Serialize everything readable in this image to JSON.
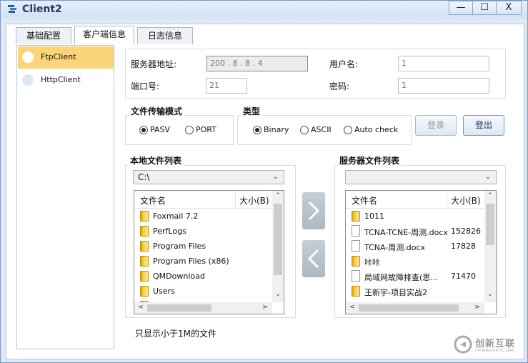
{
  "window": {
    "title": "Client2",
    "minimize": "—",
    "maximize": "☐",
    "close": "X"
  },
  "tabs": [
    "基础配置",
    "客户端信息",
    "日志信息"
  ],
  "sidebar": {
    "items": [
      {
        "label": "FtpClient",
        "selected": true
      },
      {
        "label": "HttpClient",
        "selected": false
      }
    ]
  },
  "server": {
    "address_label": "服务器地址:",
    "address_value": "200 .  8  .  8  .  4",
    "user_label": "用户名:",
    "user_value": "1",
    "port_label": "端口号:",
    "port_value": "21",
    "password_label": "密码:",
    "password_value": "1"
  },
  "transfer_mode": {
    "label": "文件传输模式",
    "options": [
      "PASV",
      "PORT"
    ],
    "selected": "PASV"
  },
  "type": {
    "label": "类型",
    "options": [
      "Binary",
      "ASCII",
      "Auto check"
    ],
    "selected": "Binary"
  },
  "buttons": {
    "login": "登录",
    "logout": "登出"
  },
  "local": {
    "label": "本地文件列表",
    "path": "C:\\",
    "col_name": "文件名",
    "col_size": "大小(B)",
    "rows": [
      "Foxmail 7.2",
      "PerfLogs",
      "Program Files",
      "Program Files (x86)",
      "QMDownload",
      "Users"
    ]
  },
  "remote": {
    "label": "服务器文件列表",
    "path": "",
    "col_name": "文件名",
    "col_size": "大小(B)",
    "rows": [
      {
        "name": "1011",
        "size": "",
        "kind": "folder"
      },
      {
        "name": "TCNA-TCNE-周测.docx",
        "size": "152826",
        "kind": "file"
      },
      {
        "name": "TCNA-周测.docx",
        "size": "17828",
        "kind": "file"
      },
      {
        "name": "咔咔",
        "size": "",
        "kind": "folder"
      },
      {
        "name": "局域网故障排查(思…",
        "size": "71470",
        "kind": "file"
      },
      {
        "name": "王新宇-项目实战2",
        "size": "",
        "kind": "folder"
      }
    ]
  },
  "note": "只显示小于1M的文件",
  "watermark": {
    "line1": "创新互联",
    "line2": "CHUANG XIN HU LIAN"
  },
  "colors": {
    "accent_selected": "#fcd57a",
    "window_border": "#7a99c2",
    "arrow_button": "#b8c2cc"
  }
}
